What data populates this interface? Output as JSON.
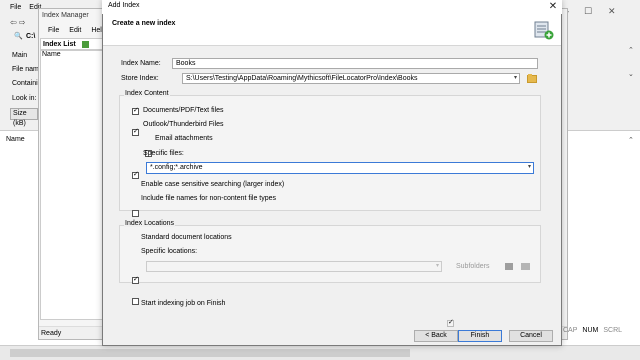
{
  "main": {
    "menu": [
      "File",
      "Edit"
    ],
    "left_labels": [
      "Main",
      "File name",
      "Containing",
      "Look in:"
    ],
    "left_box": "Size (kB)",
    "col_name": "Name",
    "cursor_text": "C:\\"
  },
  "index_manager": {
    "title": "Index Manager",
    "menu": [
      "File",
      "Edit",
      "Help"
    ],
    "list_title": "Index List",
    "col_name": "Name",
    "status": "Ready"
  },
  "status_caps": [
    "CAP",
    "NUM",
    "SCRL"
  ],
  "dialog": {
    "title": "Add Index",
    "heading": "Create a new index",
    "index_name_label": "Index Name:",
    "index_name_value": "Books",
    "store_index_label": "Store Index:",
    "store_index_value": "S:\\Users\\Testing\\AppData\\Roaming\\Mythicsoft\\FileLocatorPro\\Index\\Books",
    "content_group_title": "Index Content",
    "content_options": {
      "documents": {
        "label": "Documents/PDF/Text files",
        "checked": true
      },
      "outlook": {
        "label": "Outlook/Thunderbird Files",
        "checked": true
      },
      "email": {
        "label": "Email attachments",
        "checked": false
      },
      "specific": {
        "label": "Specific files:",
        "checked": true
      }
    },
    "specific_files_value": "*.config;*.archive",
    "case_sensitive": {
      "label": "Enable case sensitive searching (larger index)",
      "checked": false
    },
    "include_names": {
      "label": "Include file names for non-content file types",
      "checked": false
    },
    "locations_group_title": "Index Locations",
    "standard_locations": {
      "label": "Standard document locations",
      "checked": true
    },
    "specific_locations": {
      "label": "Specific locations:",
      "checked": false
    },
    "subfolders": {
      "label": "Subfolders",
      "checked": true
    },
    "start_indexing": {
      "label": "Start indexing job on Finish",
      "checked": true
    },
    "buttons": {
      "back": "< Back",
      "finish": "Finish",
      "cancel": "Cancel"
    }
  },
  "colors": {
    "accent": "#3b7ad7",
    "folder": "#e6b94e"
  }
}
